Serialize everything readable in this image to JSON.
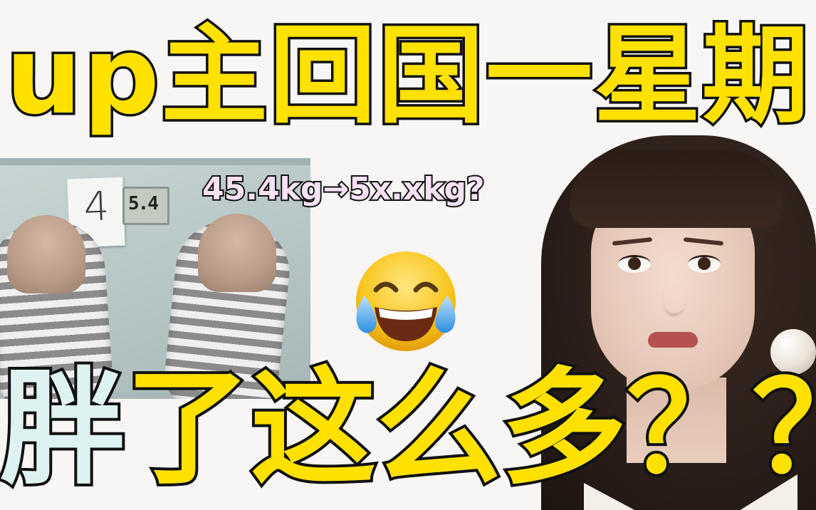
{
  "title": "up主回国一星期",
  "weight_change": "45.4kg→5x.xkg?",
  "scale": {
    "note_digit": "4",
    "display_reading": "5.4"
  },
  "emoji": {
    "icon": "face-with-tears-of-joy-icon"
  },
  "caption": {
    "first_char": "胖",
    "rest": "了这么多？？"
  },
  "colors": {
    "title_fill": "#ffe100",
    "outline": "#111111",
    "weight_fill": "#f6e2f4",
    "caption_first_fill": "#dff2f2",
    "caption_rest_fill": "#ffe100"
  }
}
